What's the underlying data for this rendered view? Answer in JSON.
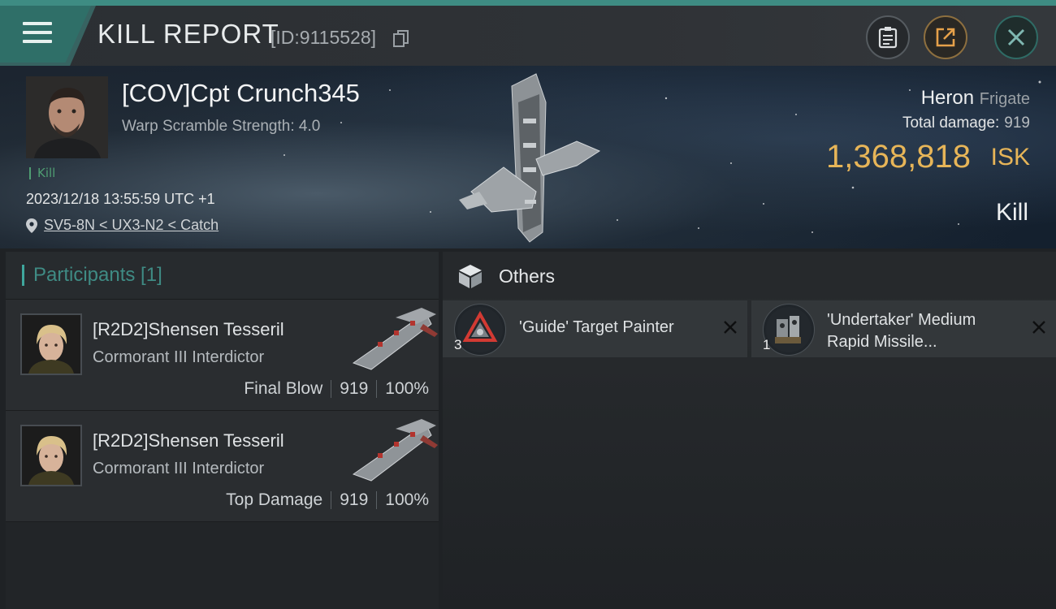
{
  "header": {
    "title": "KILL REPORT",
    "report_id": "[ID:9115528]"
  },
  "victim": {
    "name": "[COV]Cpt Crunch345",
    "warp_scramble": "Warp Scramble Strength: 4.0",
    "kill_tag": "Kill",
    "timestamp": "2023/12/18 13:55:59 UTC +1",
    "location": "SV5-8N < UX3-N2 < Catch"
  },
  "ship": {
    "name": "Heron",
    "class": "Frigate",
    "total_damage_label": "Total damage:",
    "total_damage_value": "919",
    "isk_value": "1,368,818",
    "isk_unit": "ISK",
    "outcome": "Kill"
  },
  "participants": {
    "title": "Participants [1]",
    "items": [
      {
        "name": "[R2D2]Shensen Tesseril",
        "ship": "Cormorant III Interdictor",
        "role": "Final Blow",
        "damage": "919",
        "percent": "100%"
      },
      {
        "name": "[R2D2]Shensen Tesseril",
        "ship": "Cormorant III Interdictor",
        "role": "Top Damage",
        "damage": "919",
        "percent": "100%"
      }
    ]
  },
  "others": {
    "title": "Others",
    "items": [
      {
        "name": "'Guide' Target Painter",
        "quantity": "3"
      },
      {
        "name_line1": "'Undertaker' Medium",
        "name_line2": "Rapid Missile...",
        "quantity": "1"
      }
    ]
  },
  "colors": {
    "accent": "#3fa79d",
    "isk": "#e7b558",
    "kill_tag": "#4f9d72"
  },
  "icons": [
    "menu-icon",
    "copy-icon",
    "clipboard-icon",
    "share-icon",
    "close-icon",
    "location-pin-icon",
    "cube-icon",
    "remove-icon"
  ]
}
